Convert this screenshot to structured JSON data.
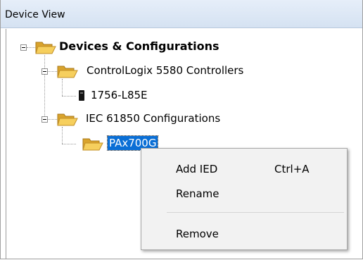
{
  "panel": {
    "title": "Device View"
  },
  "tree": {
    "root": {
      "label": "Devices & Configurations",
      "icon": "folder-open-icon"
    },
    "controllers_group": {
      "label": "ControlLogix 5580 Controllers",
      "icon": "folder-open-icon"
    },
    "controller": {
      "label": "1756-L85E",
      "icon": "controller-module-icon"
    },
    "iec_group": {
      "label": "IEC 61850 Configurations",
      "icon": "folder-open-icon"
    },
    "configuration": {
      "label": "PAx700G",
      "icon": "folder-open-icon",
      "selected": true
    }
  },
  "context_menu": {
    "items": [
      {
        "label": "Add IED",
        "shortcut": "Ctrl+A"
      },
      {
        "label": "Rename",
        "shortcut": ""
      },
      {
        "label": "Remove",
        "shortcut": ""
      }
    ]
  },
  "colors": {
    "selection": "#0a6fd6",
    "folder": "#f3c34a",
    "header": "#dce7f5"
  }
}
